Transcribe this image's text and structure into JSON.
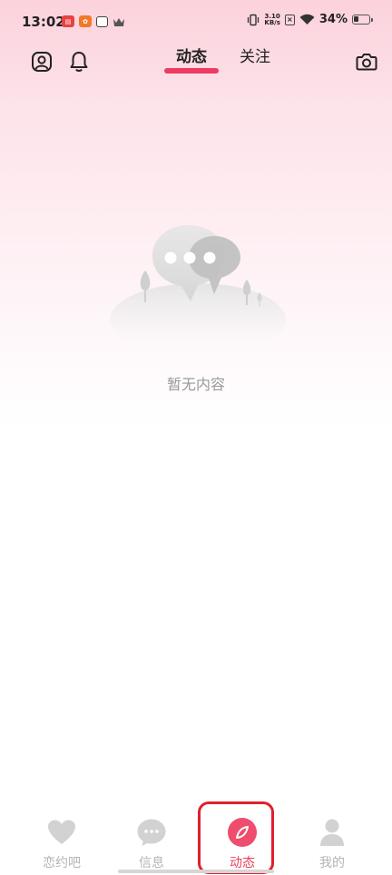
{
  "status_bar": {
    "time": "13:02",
    "net_speed_value": "3.10",
    "net_speed_unit": "KB/s",
    "battery": "34%"
  },
  "header": {
    "tabs": [
      {
        "label": "动态",
        "active": true
      },
      {
        "label": "关注",
        "active": false
      }
    ]
  },
  "empty_state": {
    "message": "暂无内容"
  },
  "bottom_nav": {
    "items": [
      {
        "label": "恋约吧",
        "icon": "heart-icon"
      },
      {
        "label": "信息",
        "icon": "chat-bubble-icon"
      },
      {
        "label": "动态",
        "icon": "compass-icon",
        "active": true
      },
      {
        "label": "我的",
        "icon": "person-icon"
      }
    ]
  },
  "colors": {
    "accent": "#ee3b63",
    "inactive": "#b4b4b4",
    "annotation": "#e0202c"
  }
}
